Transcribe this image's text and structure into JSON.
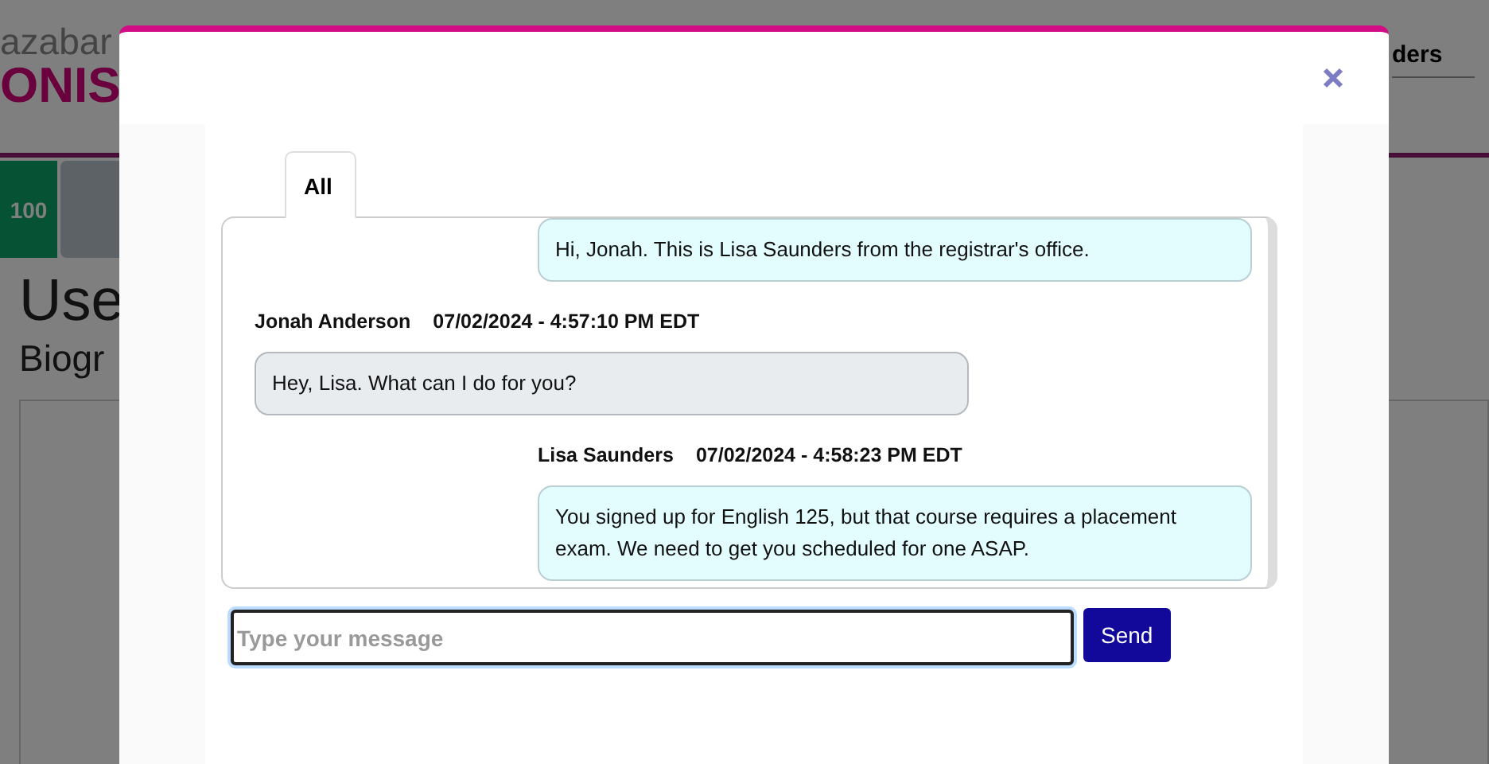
{
  "background_page": {
    "logo_top": "azabar",
    "logo_bottom": "ONIS",
    "nav_link": "ders",
    "score": "100",
    "heading": "Use",
    "subheading": "Biogr"
  },
  "dialog": {
    "tabs": [
      {
        "label": "All",
        "selected": true
      }
    ],
    "messages": [
      {
        "kind": "sent",
        "text": "Hi, Jonah. This is Lisa Saunders from the registrar's office."
      },
      {
        "kind": "received",
        "sender": "Jonah Anderson",
        "time": "07/02/2024 - 4:57:10 PM EDT",
        "text": "Hey, Lisa. What can I do for you?"
      },
      {
        "kind": "sent",
        "sender": "Lisa Saunders",
        "time": "07/02/2024 - 4:58:23 PM EDT",
        "text": "You signed up for English 125, but that course requires a placement exam. We need to get you scheduled for one ASAP."
      }
    ],
    "input": {
      "placeholder": "Type your message"
    },
    "send_button": "Send"
  }
}
